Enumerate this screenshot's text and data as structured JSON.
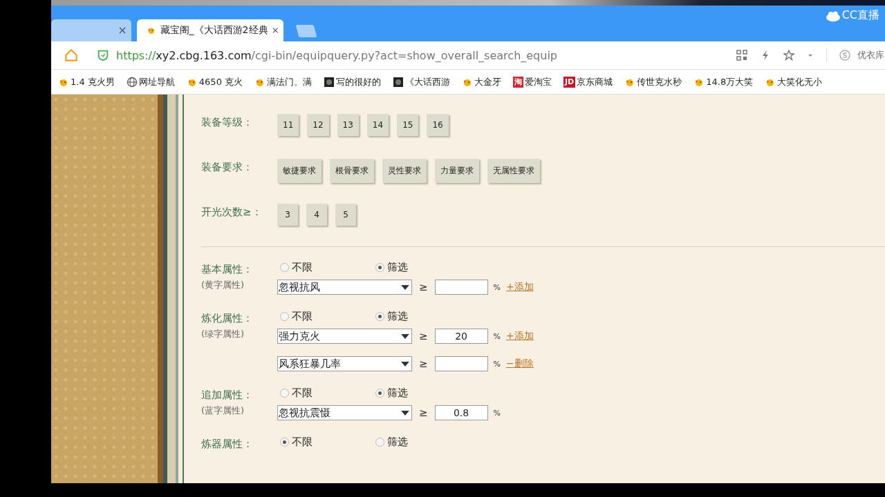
{
  "browser": {
    "brand": "CC直播",
    "tabs": [
      {
        "selected": false
      },
      {
        "label": "藏宝阁_《大话西游2经典",
        "selected": true
      }
    ],
    "url": {
      "scheme": "https://",
      "host": "xy2.cbg.163.com",
      "path": "/cgi-bin/equipquery.py?act=show_overall_search_equip"
    },
    "account": "优衣库",
    "bookmarks": [
      {
        "kind": "chick",
        "label": "1.4 克火男"
      },
      {
        "kind": "globe",
        "label": "网址导航"
      },
      {
        "kind": "chick",
        "label": "4650 克火"
      },
      {
        "kind": "chick",
        "label": "满法门。满"
      },
      {
        "kind": "dark",
        "label": "写的很好的"
      },
      {
        "kind": "dark",
        "label": "《大话西游"
      },
      {
        "kind": "chick",
        "label": "大金牙"
      },
      {
        "kind": "badge",
        "badge": "淘",
        "color": "#d9262c",
        "label": "爱淘宝"
      },
      {
        "kind": "badge",
        "badge": "JD",
        "color": "#c81623",
        "label": "京东商城"
      },
      {
        "kind": "chick",
        "label": "传世克水秒"
      },
      {
        "kind": "chick",
        "label": "14.8万大笑"
      },
      {
        "kind": "chick",
        "label": "大笑化无小"
      }
    ]
  },
  "filters": [
    {
      "label": "装备等级：",
      "options": [
        "11",
        "12",
        "13",
        "14",
        "15",
        "16"
      ]
    },
    {
      "label": "装备要求：",
      "options": [
        "敏捷要求",
        "根骨要求",
        "灵性要求",
        "力量要求",
        "无属性要求"
      ]
    },
    {
      "label": "开光次数≥：",
      "options": [
        "3",
        "4",
        "5"
      ]
    }
  ],
  "attributes": [
    {
      "label": "基本属性：",
      "sublabel": "(黄字属性)",
      "radios": [
        {
          "label": "不限",
          "selected": false
        },
        {
          "label": "筛选",
          "selected": true
        }
      ],
      "rows": [
        {
          "attribute": "忽视抗风",
          "op": "≥",
          "value": "",
          "unit": "%",
          "link": "+添加"
        }
      ]
    },
    {
      "label": "炼化属性：",
      "sublabel": "(绿字属性)",
      "radios": [
        {
          "label": "不限",
          "selected": false
        },
        {
          "label": "筛选",
          "selected": true
        }
      ],
      "rows": [
        {
          "attribute": "强力克火",
          "op": "≥",
          "value": "20",
          "unit": "%",
          "link": "+添加"
        },
        {
          "attribute": "风系狂暴几率",
          "op": "≥",
          "value": "",
          "unit": "%",
          "link": "−删除"
        }
      ]
    },
    {
      "label": "追加属性：",
      "sublabel": "(蓝字属性)",
      "radios": [
        {
          "label": "不限",
          "selected": false
        },
        {
          "label": "筛选",
          "selected": true
        }
      ],
      "rows": [
        {
          "attribute": "忽视抗震慑",
          "op": "≥",
          "value": "0.8",
          "unit": "%"
        }
      ]
    },
    {
      "label": "炼器属性：",
      "radios": [
        {
          "label": "不限",
          "selected": true
        },
        {
          "label": "筛选",
          "selected": false
        }
      ]
    }
  ]
}
